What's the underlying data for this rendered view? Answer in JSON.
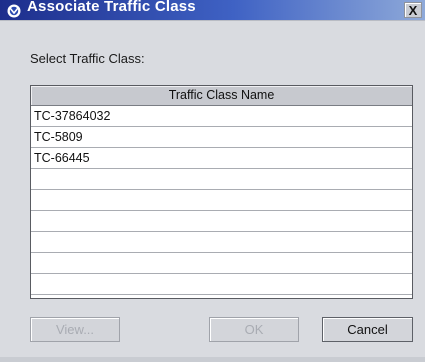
{
  "window": {
    "title": "Associate Traffic Class",
    "close_glyph": "X",
    "icon": "app-logo-icon"
  },
  "prompt": "Select Traffic Class:",
  "table": {
    "column_header": "Traffic Class Name",
    "rows": [
      "TC-37864032",
      "TC-5809",
      "TC-66445",
      "",
      "",
      "",
      "",
      "",
      ""
    ]
  },
  "buttons": {
    "view": "View...",
    "ok": "OK",
    "cancel": "Cancel"
  },
  "colors": {
    "titlebar_start": "#1d2e8c",
    "titlebar_end": "#8ea9d9",
    "dialog_bg": "#d9dbe0"
  }
}
